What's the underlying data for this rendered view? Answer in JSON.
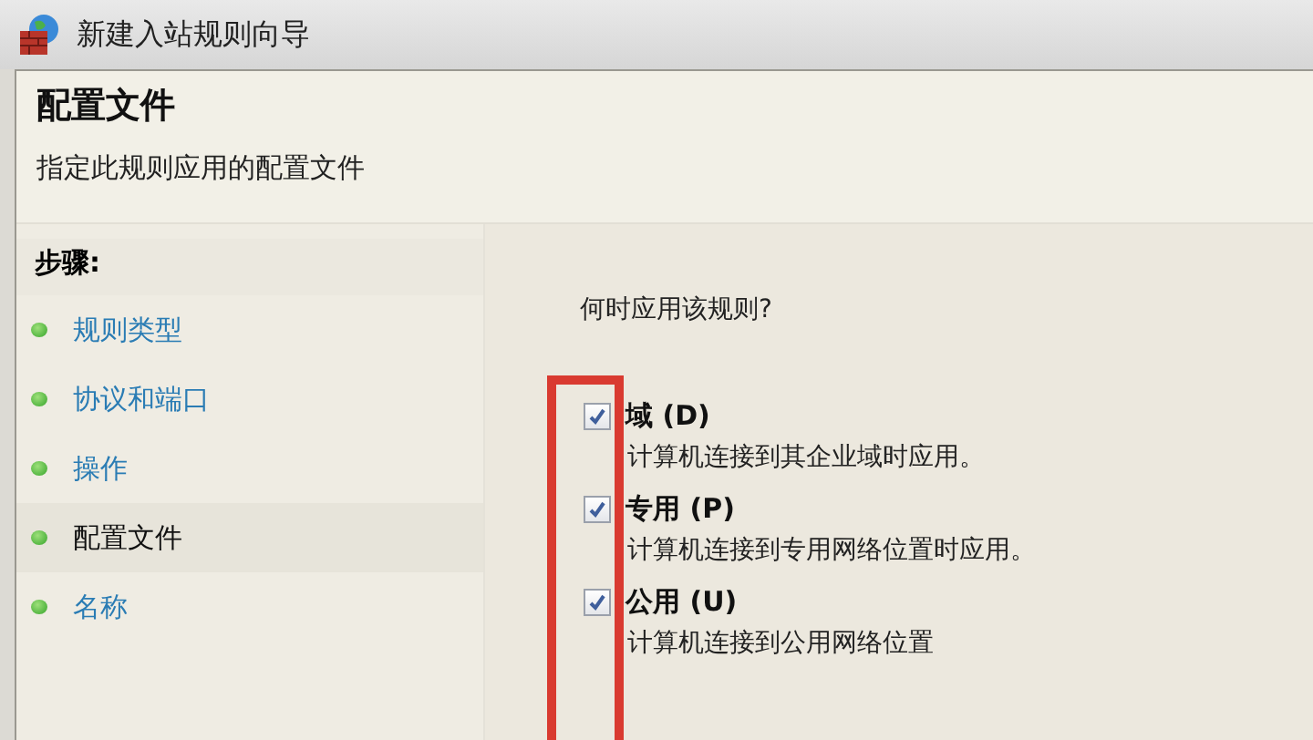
{
  "window": {
    "title": "新建入站规则向导"
  },
  "header": {
    "title": "配置文件",
    "subtitle": "指定此规则应用的配置文件"
  },
  "steps": {
    "heading": "步骤:",
    "items": [
      {
        "label": "规则类型",
        "selected": false
      },
      {
        "label": "协议和端口",
        "selected": false
      },
      {
        "label": "操作",
        "selected": false
      },
      {
        "label": "配置文件",
        "selected": true
      },
      {
        "label": "名称",
        "selected": false
      }
    ]
  },
  "content": {
    "question": "何时应用该规则?",
    "profiles": [
      {
        "label": "域 (D)",
        "checked": true,
        "description": "计算机连接到其企业域时应用。"
      },
      {
        "label": "专用 (P)",
        "checked": true,
        "description": "计算机连接到专用网络位置时应用。"
      },
      {
        "label": "公用 (U)",
        "checked": true,
        "description": "计算机连接到公用网络位置"
      }
    ]
  }
}
